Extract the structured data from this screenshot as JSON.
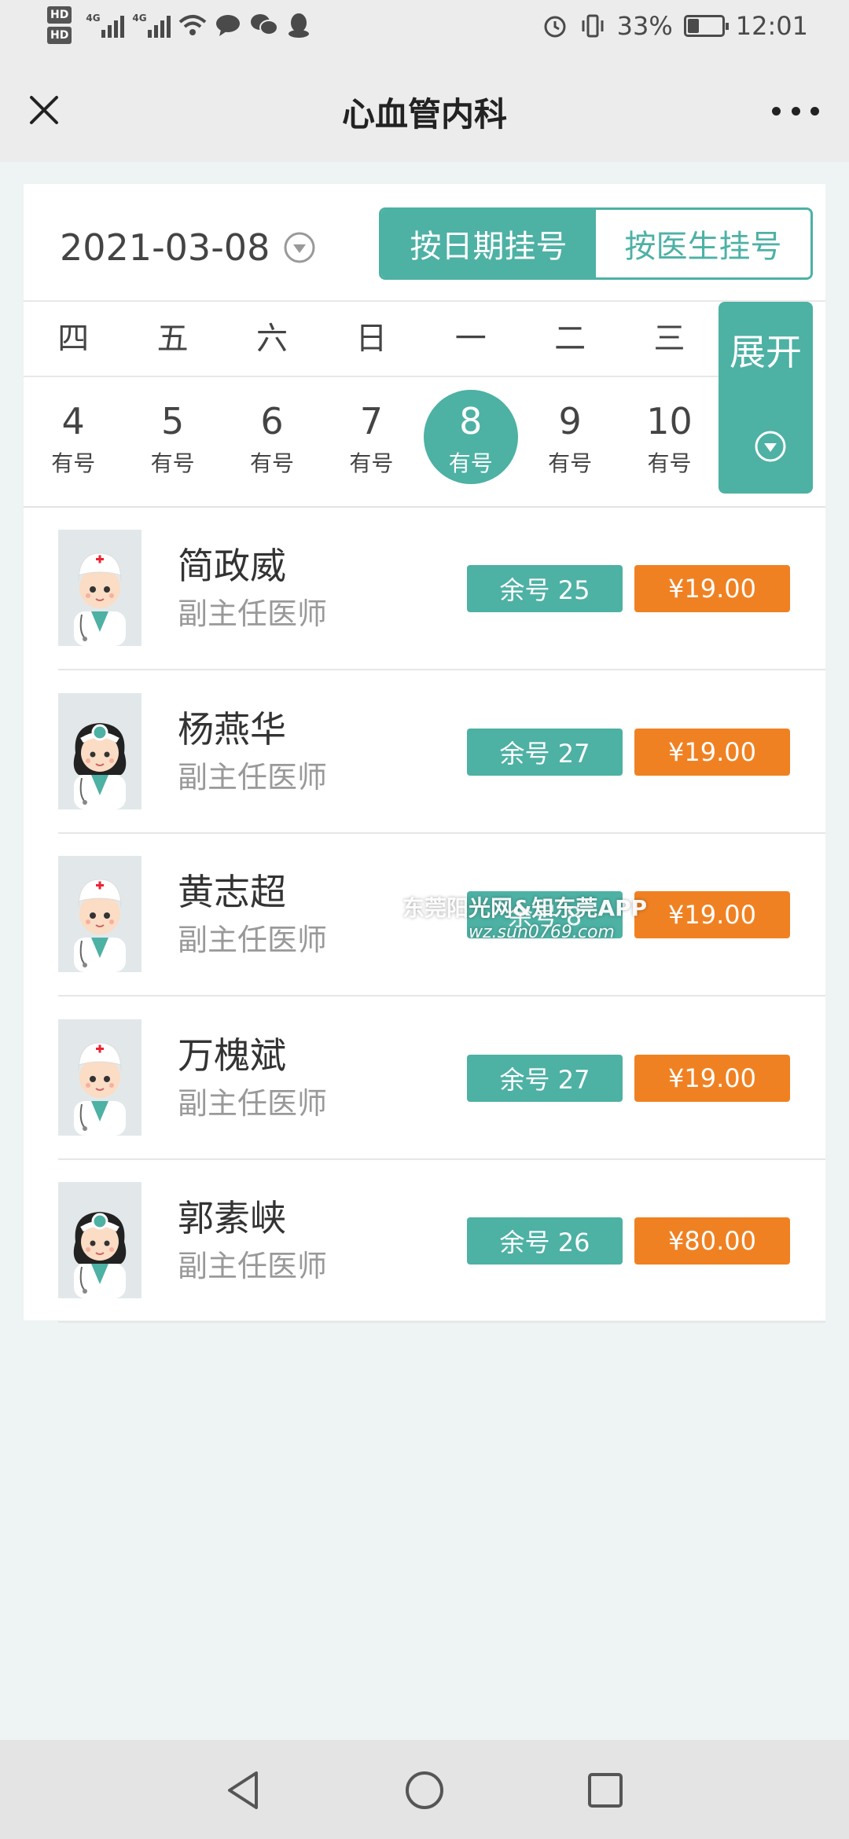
{
  "status_bar": {
    "hd1": "HD",
    "hd2": "HD",
    "net1": "4G",
    "net2": "4G",
    "battery_percent": "33%",
    "battery_level": 0.33,
    "time": "12:01"
  },
  "header": {
    "title": "心血管内科",
    "close_icon": "close-icon",
    "more_icon": "more-icon"
  },
  "date_selector": {
    "selected_date": "2021-03-08"
  },
  "mode_toggle": {
    "by_date": "按日期挂号",
    "by_doctor": "按医生挂号",
    "active": "by_date"
  },
  "calendar": {
    "weekdays": [
      "四",
      "五",
      "六",
      "日",
      "一",
      "二",
      "三"
    ],
    "days": [
      {
        "num": "4",
        "status": "有号"
      },
      {
        "num": "5",
        "status": "有号"
      },
      {
        "num": "6",
        "status": "有号"
      },
      {
        "num": "7",
        "status": "有号"
      },
      {
        "num": "8",
        "status": "有号"
      },
      {
        "num": "9",
        "status": "有号"
      },
      {
        "num": "10",
        "status": "有号"
      }
    ],
    "selected_index": 4,
    "expand_label": "展开"
  },
  "doctors": [
    {
      "name": "简政威",
      "title": "副主任医师",
      "slots": "余号 25",
      "price": "¥19.00",
      "avatar": "male-doctor"
    },
    {
      "name": "杨燕华",
      "title": "副主任医师",
      "slots": "余号 27",
      "price": "¥19.00",
      "avatar": "female-doctor"
    },
    {
      "name": "黄志超",
      "title": "副主任医师",
      "slots": "余号 8",
      "price": "¥19.00",
      "avatar": "male-doctor"
    },
    {
      "name": "万槐斌",
      "title": "副主任医师",
      "slots": "余号 27",
      "price": "¥19.00",
      "avatar": "male-doctor"
    },
    {
      "name": "郭素峡",
      "title": "副主任医师",
      "slots": "余号 26",
      "price": "¥80.00",
      "avatar": "female-doctor"
    }
  ],
  "watermark": {
    "line1": "东莞阳光网&知东莞APP",
    "line2": "wz.sun0769.com"
  },
  "colors": {
    "teal": "#4db1a4",
    "orange": "#f08122",
    "background": "#eef3f4"
  }
}
